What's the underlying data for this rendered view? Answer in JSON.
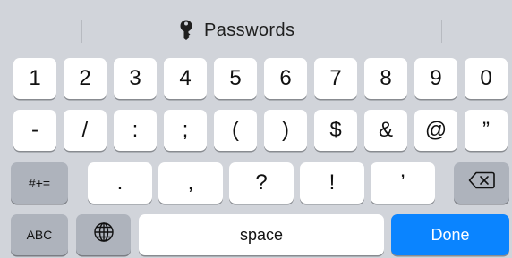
{
  "suggestion_bar": {
    "passwords_label": "Passwords",
    "icon": "key-icon"
  },
  "rows": {
    "numbers": [
      "1",
      "2",
      "3",
      "4",
      "5",
      "6",
      "7",
      "8",
      "9",
      "0"
    ],
    "symbols": [
      "-",
      "/",
      ":",
      ";",
      "(",
      ")",
      "$",
      "&",
      "@",
      "”"
    ],
    "punctuation": [
      ".",
      ",",
      "?",
      "!",
      "’"
    ]
  },
  "keys": {
    "more_symbols": "#+=",
    "abc": "ABC",
    "space": "space",
    "done": "Done",
    "globe_icon": "globe-icon",
    "delete_icon": "backspace-icon"
  },
  "colors": {
    "background": "#d1d4da",
    "key": "#ffffff",
    "function_key": "#aeb3bc",
    "done": "#0a84ff"
  }
}
